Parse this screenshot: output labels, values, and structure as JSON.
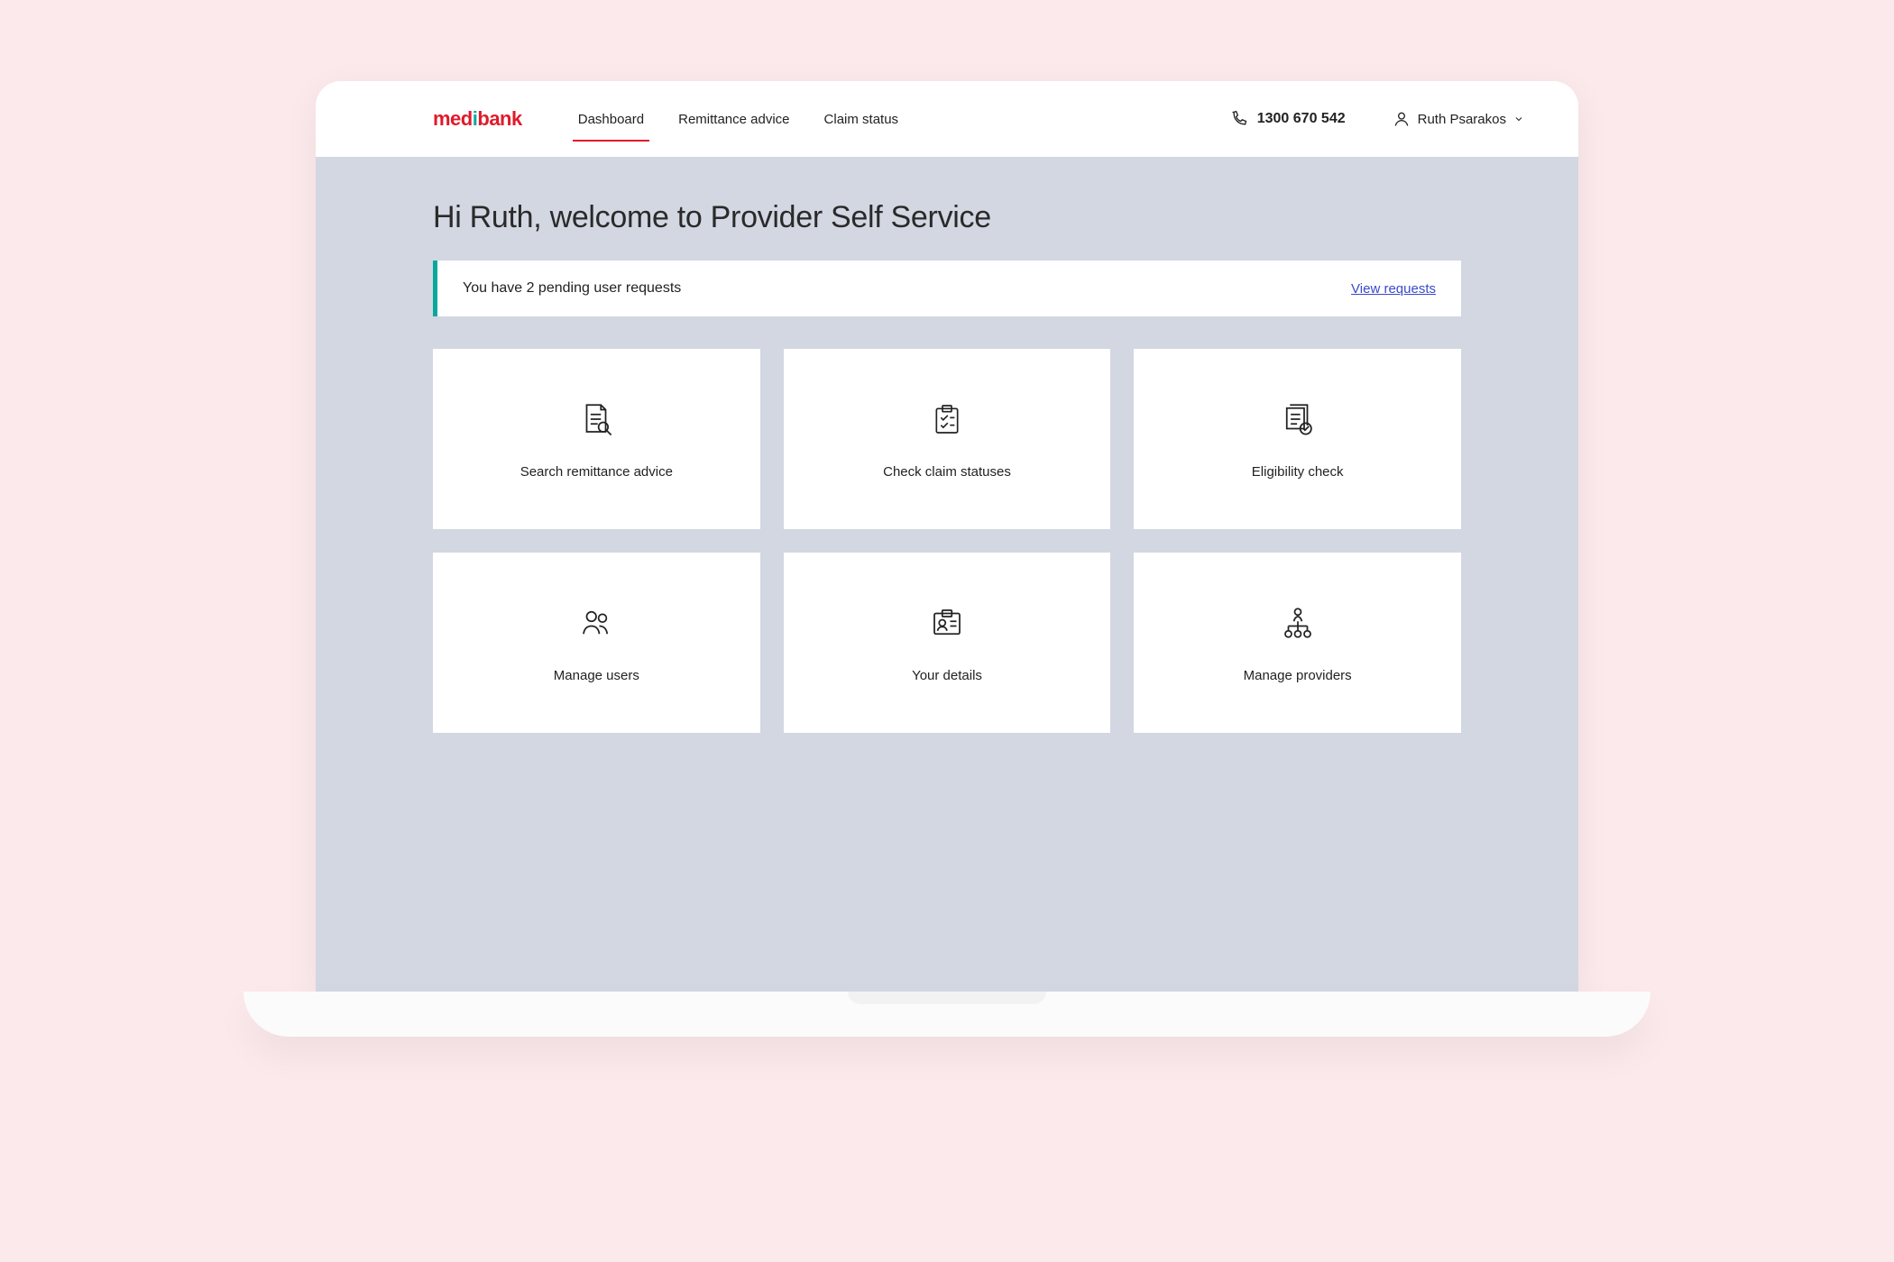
{
  "logo": {
    "prefix": "med",
    "i": "i",
    "suffix": "bank"
  },
  "nav": {
    "items": [
      {
        "label": "Dashboard",
        "active": true
      },
      {
        "label": "Remittance advice",
        "active": false
      },
      {
        "label": "Claim status",
        "active": false
      }
    ]
  },
  "phone": {
    "number": "1300 670 542"
  },
  "user": {
    "name": "Ruth Psarakos"
  },
  "main": {
    "welcome": "Hi Ruth, welcome to Provider Self Service",
    "alert": {
      "message": "You have 2 pending user requests",
      "link_label": "View requests"
    },
    "cards": [
      {
        "label": "Search remittance advice",
        "icon": "document-search-icon"
      },
      {
        "label": "Check claim statuses",
        "icon": "checklist-icon"
      },
      {
        "label": "Eligibility check",
        "icon": "document-check-icon"
      },
      {
        "label": "Manage users",
        "icon": "users-icon"
      },
      {
        "label": "Your details",
        "icon": "id-card-icon"
      },
      {
        "label": "Manage providers",
        "icon": "hierarchy-icon"
      }
    ]
  },
  "colors": {
    "brand_red": "#e01a2b",
    "brand_teal": "#0aa79d",
    "panel_bg": "#d2d7e2",
    "link": "#3a4ac8"
  }
}
